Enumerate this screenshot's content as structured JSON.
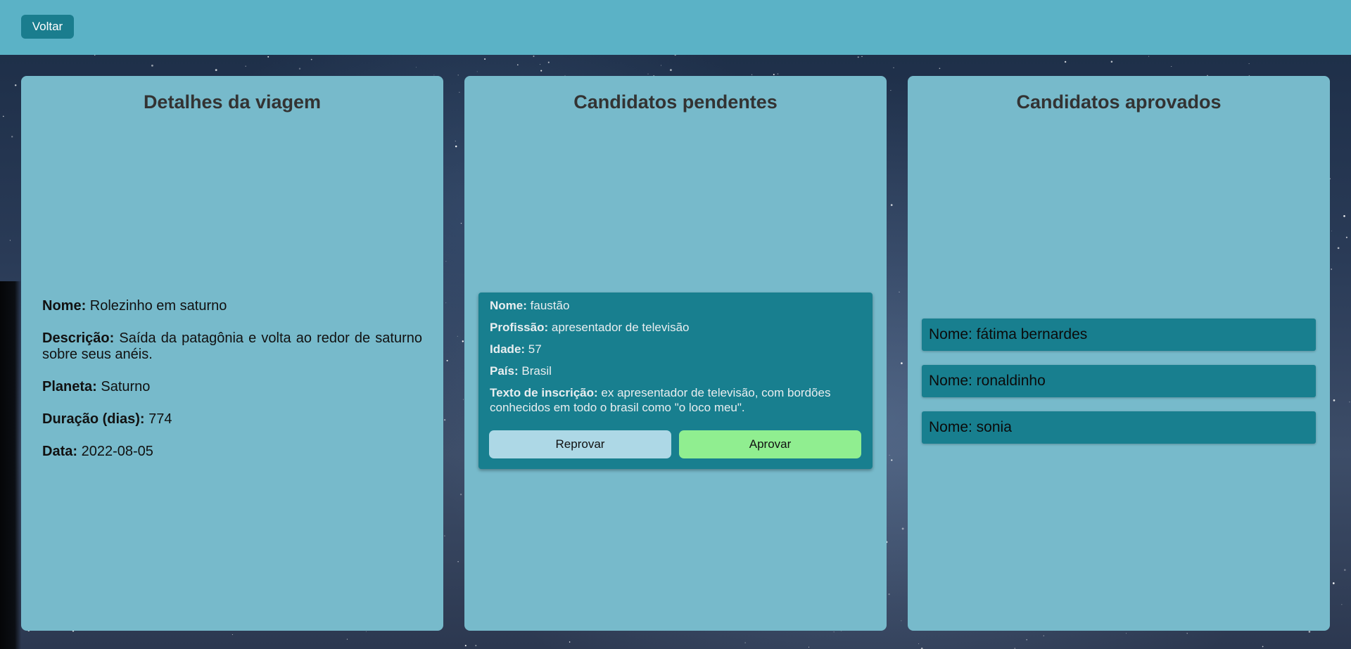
{
  "header": {
    "back_label": "Voltar"
  },
  "details": {
    "title": "Detalhes da viagem",
    "name_label": "Nome:",
    "name_value": "Rolezinho em saturno",
    "description_label": "Descrição:",
    "description_value": "Saída da patagônia e volta ao redor de saturno sobre seus anéis.",
    "planet_label": "Planeta:",
    "planet_value": "Saturno",
    "duration_label": "Duração (dias):",
    "duration_value": "774",
    "date_label": "Data:",
    "date_value": "2022-08-05"
  },
  "pending": {
    "title": "Candidatos pendentes",
    "candidates": [
      {
        "name_label": "Nome:",
        "name": "faustão",
        "profession_label": "Profissão:",
        "profession": "apresentador de televisão",
        "age_label": "Idade:",
        "age": "57",
        "country_label": "País:",
        "country": "Brasil",
        "text_label": "Texto de inscrição:",
        "text": "ex apresentador de televisão, com bordões conhecidos em todo o brasil como \"o loco meu\".",
        "reject_label": "Reprovar",
        "approve_label": "Aprovar"
      }
    ]
  },
  "approved": {
    "title": "Candidatos aprovados",
    "items": [
      "Nome: fátima bernardes",
      "Nome: ronaldinho",
      "Nome: sonia"
    ]
  },
  "colors": {
    "header": "#5bb2c6",
    "panel": "#77bacb",
    "card": "#187f8f",
    "reject": "#add8e6",
    "approve": "#90ee90"
  }
}
